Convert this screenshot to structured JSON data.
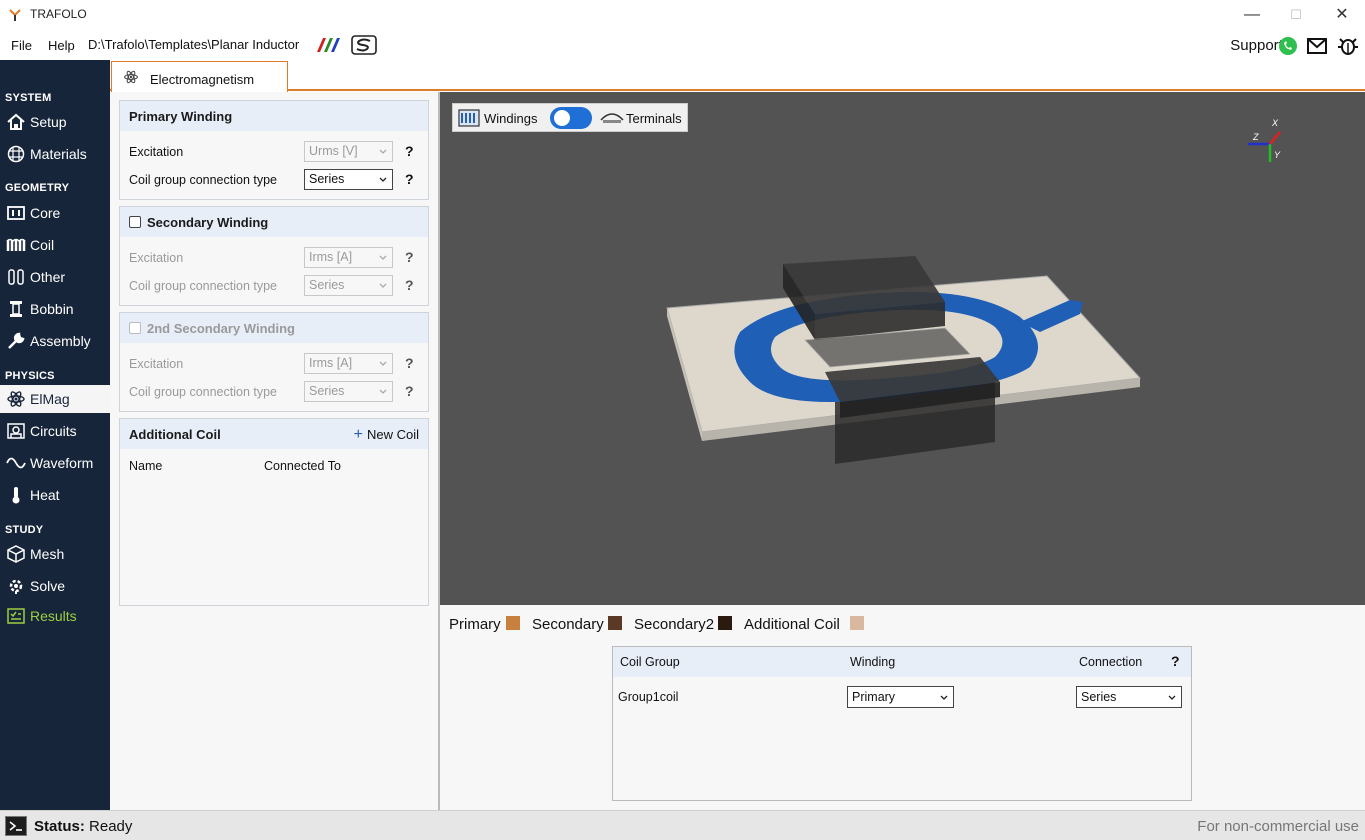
{
  "window": {
    "title": "TRAFOLO",
    "minimize": "—",
    "maximize": "☐",
    "close": "✕"
  },
  "menu": {
    "file": "File",
    "help": "Help",
    "path": "D:\\Trafolo\\Templates\\Planar Inductor",
    "support": "Support:"
  },
  "sidebar": {
    "system": "SYSTEM",
    "setup": "Setup",
    "materials": "Materials",
    "geometry": "GEOMETRY",
    "core": "Core",
    "coil": "Coil",
    "other": "Other",
    "bobbin": "Bobbin",
    "assembly": "Assembly",
    "physics": "PHYSICS",
    "elmag": "ElMag",
    "circuits": "Circuits",
    "waveform": "Waveform",
    "heat": "Heat",
    "study": "STUDY",
    "mesh": "Mesh",
    "solve": "Solve",
    "results": "Results"
  },
  "tab": {
    "label": "Electromagnetism"
  },
  "primary": {
    "title": "Primary Winding",
    "excitation_label": "Excitation",
    "excitation_value": "Urms [V]",
    "connection_label": "Coil group connection type",
    "connection_value": "Series",
    "help": "?"
  },
  "secondary": {
    "title": "Secondary Winding",
    "excitation_label": "Excitation",
    "excitation_value": "Irms [A]",
    "connection_label": "Coil group connection type",
    "connection_value": "Series",
    "help": "?"
  },
  "secondary2": {
    "title": "2nd Secondary Winding",
    "excitation_label": "Excitation",
    "excitation_value": "Irms [A]",
    "connection_label": "Coil group connection type",
    "connection_value": "Series",
    "help": "?"
  },
  "additional": {
    "title": "Additional Coil",
    "new_coil": "New Coil",
    "plus": "+",
    "col_name": "Name",
    "col_connected": "Connected To"
  },
  "viewport": {
    "windings": "Windings",
    "terminals": "Terminals",
    "axis_x": "X",
    "axis_y": "Y",
    "axis_z": "Z",
    "toggle_on": true
  },
  "legend": [
    {
      "label": "Primary",
      "color": "#c8803f"
    },
    {
      "label": "Secondary",
      "color": "#5a3a24"
    },
    {
      "label": "Secondary2",
      "color": "#2a1a10"
    },
    {
      "label": "Additional Coil",
      "color": "#d9b8a0"
    }
  ],
  "coil_table": {
    "col_group": "Coil Group",
    "col_winding": "Winding",
    "col_connection": "Connection",
    "help": "?",
    "rows": [
      {
        "group": "Group1coil",
        "winding": "Primary",
        "connection": "Series"
      }
    ]
  },
  "status": {
    "label": "Status:",
    "value": "Ready",
    "license": "For non-commercial use"
  },
  "colors": {
    "sidebar": "#17253a",
    "accent": "#e07b2a",
    "results": "#9ccf3f",
    "coil_blue": "#1f5fb5"
  }
}
